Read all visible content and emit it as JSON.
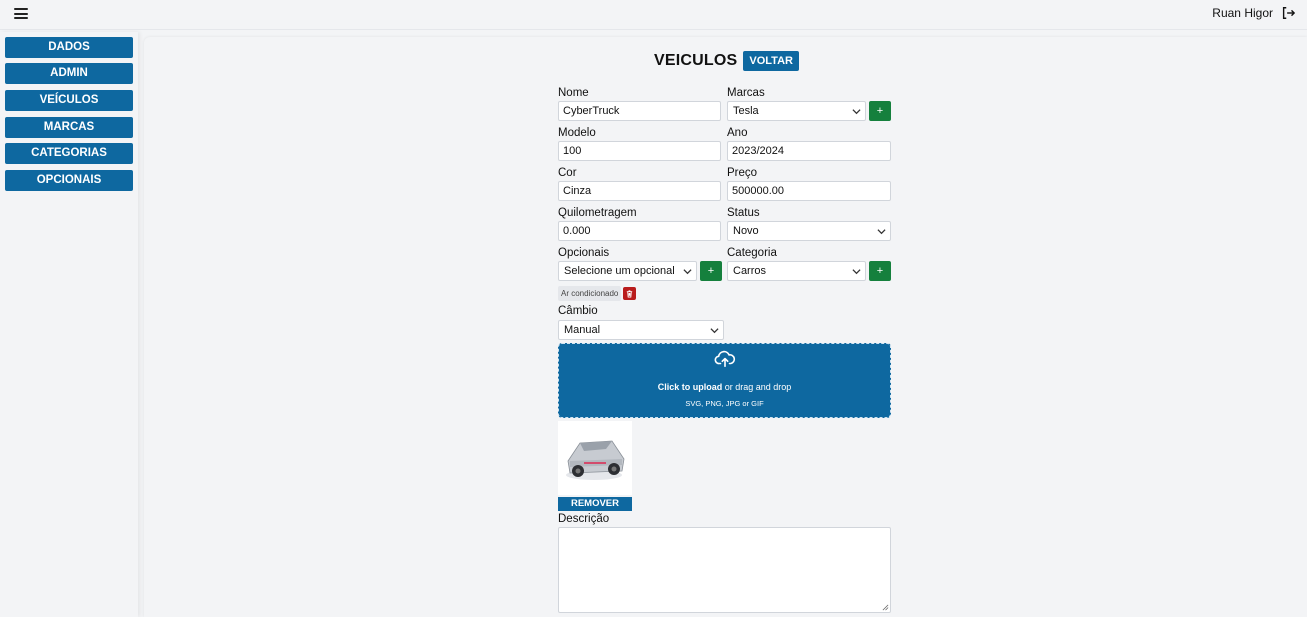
{
  "header": {
    "user_name": "Ruan Higor",
    "menu_icon": "hamburger-menu-icon",
    "logout_icon": "logout-icon"
  },
  "sidebar": {
    "items": [
      {
        "label": "DADOS"
      },
      {
        "label": "ADMIN"
      },
      {
        "label": "VEÍCULOS"
      },
      {
        "label": "MARCAS"
      },
      {
        "label": "CATEGORIAS"
      },
      {
        "label": "OPCIONAIS"
      }
    ]
  },
  "page": {
    "title": "VEICULOS",
    "back_label": "VOLTAR"
  },
  "form": {
    "nome": {
      "label": "Nome",
      "value": "CyberTruck"
    },
    "marcas": {
      "label": "Marcas",
      "value": "Tesla",
      "add": "+"
    },
    "modelo": {
      "label": "Modelo",
      "value": "100"
    },
    "ano": {
      "label": "Ano",
      "value": "2023/2024"
    },
    "cor": {
      "label": "Cor",
      "value": "Cinza"
    },
    "preco": {
      "label": "Preço",
      "value": "500000.00"
    },
    "quilometragem": {
      "label": "Quilometragem",
      "value": "0.000"
    },
    "status": {
      "label": "Status",
      "value": "Novo"
    },
    "opcionais": {
      "label": "Opcionais",
      "value": "Selecione um opcional",
      "add": "+",
      "selected_chip": "Ar condicionado"
    },
    "categoria": {
      "label": "Categoria",
      "value": "Carros",
      "add": "+"
    },
    "cambio": {
      "label": "Câmbio",
      "value": "Manual"
    },
    "upload": {
      "bold": "Click to upload",
      "rest": " or drag and drop",
      "formats": "SVG, PNG, JPG or GIF"
    },
    "remove_label": "REMOVER",
    "descricao": {
      "label": "Descrição",
      "value": ""
    }
  },
  "colors": {
    "primary": "#0e68a0",
    "success": "#15803d",
    "danger": "#b91c1c"
  }
}
